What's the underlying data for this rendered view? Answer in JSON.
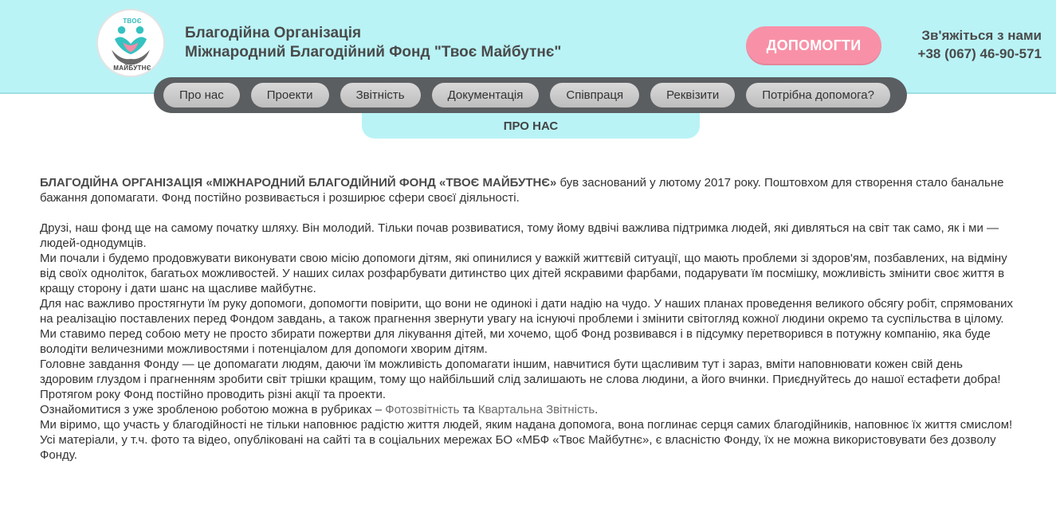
{
  "header": {
    "logo": {
      "top_text": "ТВОЄ",
      "bottom_text": "МАЙБУТНЄ",
      "colors": {
        "figure_teal": "#35c2c0",
        "figure_pink": "#f38ca6",
        "hands": "#6a6a6a"
      }
    },
    "org_line1": "Благодійна Організація",
    "org_line2": "Міжнародний Благодійний Фонд \"Твоє Майбутнє\"",
    "help_button": "ДОПОМОГТИ",
    "contact_title": "Зв'яжіться з нами",
    "contact_phone": "+38 (067) 46-90-571"
  },
  "nav": {
    "items": [
      {
        "label": "Про нас"
      },
      {
        "label": "Проекти"
      },
      {
        "label": "Звітність"
      },
      {
        "label": "Документація"
      },
      {
        "label": "Співпраця"
      },
      {
        "label": "Реквізити"
      },
      {
        "label": "Потрібна допомога?"
      }
    ]
  },
  "subnav": {
    "label": "ПРО НАС"
  },
  "article": {
    "intro_bold": "БЛАГОДІЙНА ОРГАНІЗАЦІЯ «МІЖНАРОДНИЙ БЛАГОДІЙНИЙ ФОНД «ТВОЄ МАЙБУТНЄ»",
    "intro_rest": " був заснований у лютому 2017 року. Поштовхом для створення стало банальне бажання допомагати. Фонд постійно розвивається і розширює сфери своєї діяльності.",
    "p1": "Друзі, наш фонд ще на самому початку шляху. Він молодий. Тільки почав розвиватися, тому йому вдвічі важлива підтримка людей, які дивляться на світ так само, як і ми — людей-однодумців.",
    "p2": "Ми почали і будемо продовжувати виконувати свою місію допомоги дітям, які опинилися у важкій життєвій ситуації, що мають проблеми зі здоров'ям, позбавлених, на відміну від своїх одноліток, багатьох можливостей. У наших силах розфарбувати дитинство цих дітей яскравими фарбами, подарувати їм посмішку, можливість змінити своє життя в кращу сторону і дати шанс на щасливе майбутнє.",
    "p3": "Для нас важливо простягнути їм руку допомоги, допомогти повірити, що вони не одинокі і дати надію на чудо. У наших планах проведення великого обсягу робіт, спрямованих на реалізацію поставлених перед Фондом завдань, а також прагнення звернути увагу на існуючі проблеми і змінити світогляд кожної людини окремо та суспільства в цілому.",
    "p4": "Ми ставимо перед собою мету не просто збирати пожертви для лікування дітей, ми хочемо, щоб Фонд розвивався і в підсумку перетворився в потужну компанію, яка буде володіти величезними можливостями і потенціалом для допомоги хворим дітям.",
    "p5": "Головне завдання Фонду — це допомагати людям, даючи їм можливість допомагати іншим, навчитися бути щасливим тут і зараз, вміти наповнювати кожен свій день здоровим глуздом і прагненням зробити світ трішки кращим, тому що найбільший слід залишають не слова людини, а його вчинки. Приєднуйтесь до нашої естафети добра!",
    "p6": "Протягом року Фонд постійно проводить різні акції та проекти.",
    "p7_before": "Ознайомитися з уже зробленою роботою можна в рубриках – ",
    "p7_link1": "Фотозвітність",
    "p7_mid": " та ",
    "p7_link2": "Квартальна Звітність",
    "p7_after": ".",
    "p8": "Ми віримо, що участь у благодійності не тільки наповнює радістю життя людей, яким надана допомога, вона поглинає серця самих благодійників, наповнює їх життя смислом!",
    "p9": "Усі матеріали, у т.ч. фото та відео, опубліковані на сайті та в соціальних мережах БО «МБФ «Твоє Майбутнє», є власністю Фонду, їх не можна використовувати без дозволу Фонду."
  }
}
